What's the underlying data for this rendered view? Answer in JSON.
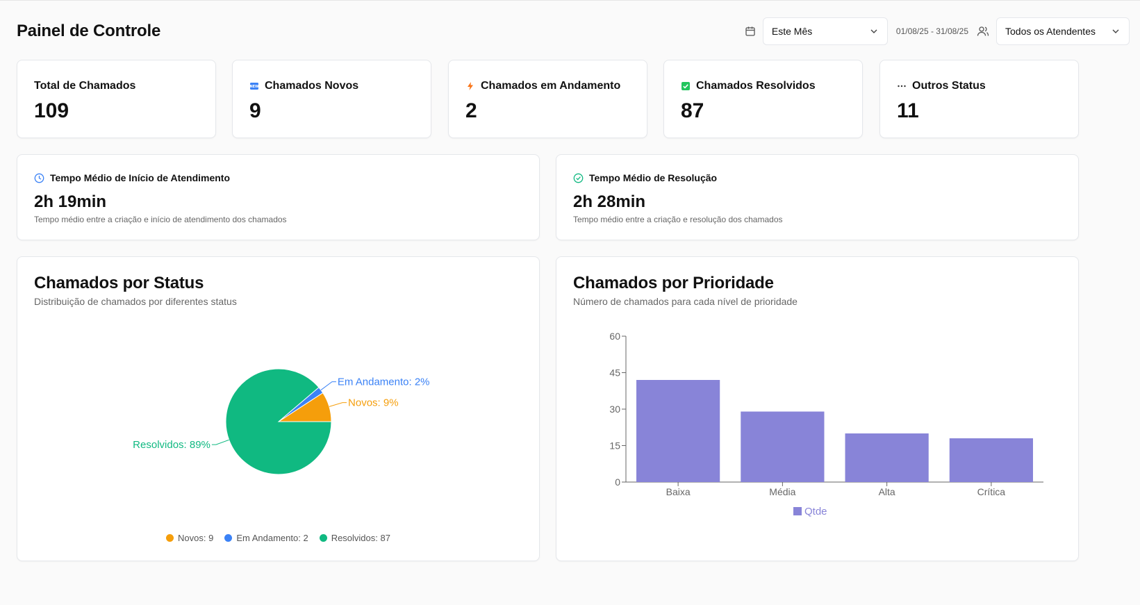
{
  "header": {
    "title": "Painel de Controle",
    "period_select": {
      "value": "Este Mês"
    },
    "date_range": "01/08/25 - 31/08/25",
    "agent_select": {
      "value": "Todos os Atendentes"
    }
  },
  "stats": [
    {
      "label": "Total de Chamados",
      "value": "109",
      "icon": "none"
    },
    {
      "label": "Chamados Novos",
      "value": "9",
      "icon": "new-badge-icon"
    },
    {
      "label": "Chamados em Andamento",
      "value": "2",
      "icon": "lightning-icon"
    },
    {
      "label": "Chamados Resolvidos",
      "value": "87",
      "icon": "check-box-icon"
    },
    {
      "label": "Outros Status",
      "value": "11",
      "icon": "ellipsis-icon"
    }
  ],
  "times": [
    {
      "label": "Tempo Médio de Início de Atendimento",
      "value": "2h 19min",
      "desc": "Tempo médio entre a criação e início de atendimento dos chamados",
      "icon": "clock-icon"
    },
    {
      "label": "Tempo Médio de Resolução",
      "value": "2h 28min",
      "desc": "Tempo médio entre a criação e resolução dos chamados",
      "icon": "check-circle-icon"
    }
  ],
  "colors": {
    "novos": "#f59e0b",
    "andamento": "#3b82f6",
    "resolvidos": "#10b981",
    "bar": "#8884d8",
    "clock": "#3b82f6",
    "check": "#10b981",
    "lightning": "#f97316"
  },
  "status_chart": {
    "title": "Chamados por Status",
    "subtitle": "Distribuição de chamados por diferentes status",
    "legend": [
      "Novos: 9",
      "Em Andamento: 2",
      "Resolvidos: 87"
    ]
  },
  "priority_chart": {
    "title": "Chamados por Prioridade",
    "subtitle": "Número de chamados para cada nível de prioridade"
  },
  "chart_data": [
    {
      "type": "pie",
      "slices": [
        {
          "name": "Novos",
          "value": 9,
          "label": "Novos: 9%"
        },
        {
          "name": "Em Andamento",
          "value": 2,
          "label": "Em Andamento: 2%"
        },
        {
          "name": "Resolvidos",
          "value": 87,
          "label": "Resolvidos: 89%"
        }
      ],
      "legend": [
        "Novos: 9",
        "Em Andamento: 2",
        "Resolvidos: 87"
      ],
      "legend_position": "bottom"
    },
    {
      "type": "bar",
      "categories": [
        "Baixa",
        "Média",
        "Alta",
        "Crítica"
      ],
      "series": [
        {
          "name": "Qtde",
          "values": [
            42,
            29,
            20,
            18
          ]
        }
      ],
      "ylim": [
        0,
        60
      ],
      "yticks": [
        0,
        15,
        30,
        45,
        60
      ],
      "grid": false,
      "legend_position": "bottom"
    }
  ]
}
